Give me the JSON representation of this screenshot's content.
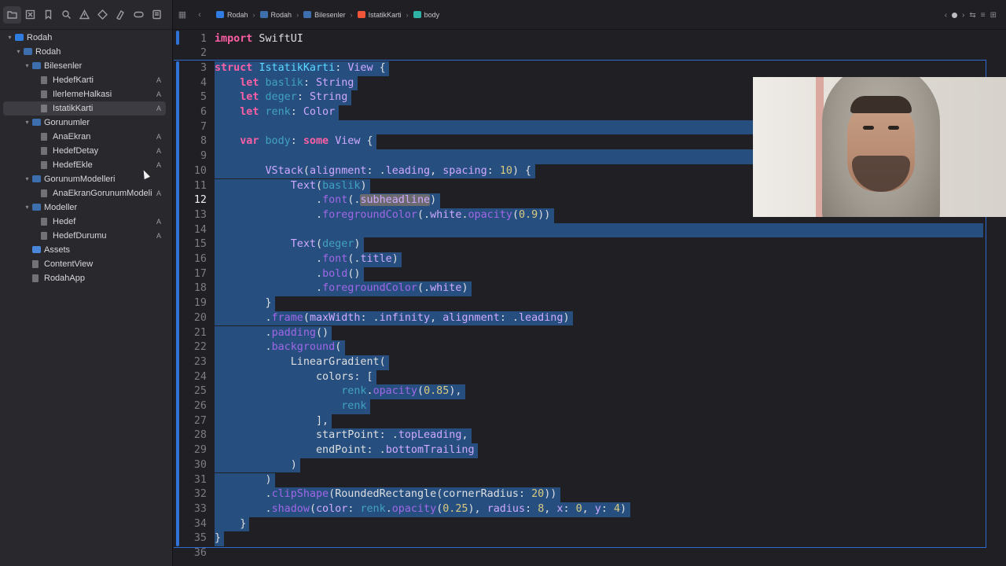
{
  "sidebar": {
    "nav_icons": [
      "folder-icon",
      "close-square-icon",
      "bookmark-icon",
      "search-icon",
      "warning-icon",
      "diamond-icon",
      "test-icon",
      "tag-icon",
      "report-icon"
    ],
    "tree": [
      {
        "label": "Rodah",
        "indent": 0,
        "chevron": "open",
        "icon": "project",
        "badge": ""
      },
      {
        "label": "Rodah",
        "indent": 1,
        "chevron": "open",
        "icon": "folder",
        "badge": ""
      },
      {
        "label": "Bilesenler",
        "indent": 2,
        "chevron": "open",
        "icon": "folder",
        "badge": ""
      },
      {
        "label": "HedefKarti",
        "indent": 3,
        "chevron": "",
        "icon": "file",
        "badge": "A"
      },
      {
        "label": "IlerlemeHalkasi",
        "indent": 3,
        "chevron": "",
        "icon": "file",
        "badge": "A"
      },
      {
        "label": "IstatikKarti",
        "indent": 3,
        "chevron": "",
        "icon": "file",
        "badge": "A",
        "selected": true
      },
      {
        "label": "Gorunumler",
        "indent": 2,
        "chevron": "open",
        "icon": "folder",
        "badge": ""
      },
      {
        "label": "AnaEkran",
        "indent": 3,
        "chevron": "",
        "icon": "file",
        "badge": "A"
      },
      {
        "label": "HedefDetay",
        "indent": 3,
        "chevron": "",
        "icon": "file",
        "badge": "A"
      },
      {
        "label": "HedefEkle",
        "indent": 3,
        "chevron": "",
        "icon": "file",
        "badge": "A"
      },
      {
        "label": "GorunumModelleri",
        "indent": 2,
        "chevron": "open",
        "icon": "folder",
        "badge": ""
      },
      {
        "label": "AnaEkranGorunumModeli",
        "indent": 3,
        "chevron": "",
        "icon": "file",
        "badge": "A"
      },
      {
        "label": "Modeller",
        "indent": 2,
        "chevron": "open",
        "icon": "folder",
        "badge": ""
      },
      {
        "label": "Hedef",
        "indent": 3,
        "chevron": "",
        "icon": "file",
        "badge": "A"
      },
      {
        "label": "HedefDurumu",
        "indent": 3,
        "chevron": "",
        "icon": "file",
        "badge": "A"
      },
      {
        "label": "Assets",
        "indent": 2,
        "chevron": "",
        "icon": "asset",
        "badge": ""
      },
      {
        "label": "ContentView",
        "indent": 2,
        "chevron": "",
        "icon": "file",
        "badge": ""
      },
      {
        "label": "RodahApp",
        "indent": 2,
        "chevron": "",
        "icon": "file",
        "badge": ""
      }
    ]
  },
  "breadcrumb": [
    {
      "label": "Rodah",
      "icon": "project",
      "color": "#2f7de0"
    },
    {
      "label": "Rodah",
      "icon": "folder",
      "color": "#3d6fae"
    },
    {
      "label": "Bilesenler",
      "icon": "folder",
      "color": "#3d6fae"
    },
    {
      "label": "IstatikKarti",
      "icon": "swift-file",
      "color": "#f0553a"
    },
    {
      "label": "body",
      "icon": "property",
      "color": "#2fb3a6"
    }
  ],
  "editor": {
    "current_line": 12,
    "selection": {
      "from_line": 3,
      "to_line": 35
    },
    "lines": [
      [
        [
          "keyword",
          "import"
        ],
        [
          "plain",
          " SwiftUI"
        ]
      ],
      [],
      [
        [
          "keyword",
          "struct"
        ],
        [
          "plain",
          " "
        ],
        [
          "type",
          "IstatikKarti"
        ],
        [
          "plain",
          ": "
        ],
        [
          "typecall",
          "View"
        ],
        [
          "plain",
          " {"
        ]
      ],
      [
        [
          "plain",
          "    "
        ],
        [
          "keyword",
          "let"
        ],
        [
          "plain",
          " "
        ],
        [
          "prop",
          "baslik"
        ],
        [
          "plain",
          ": "
        ],
        [
          "typecall",
          "String"
        ]
      ],
      [
        [
          "plain",
          "    "
        ],
        [
          "keyword",
          "let"
        ],
        [
          "plain",
          " "
        ],
        [
          "prop",
          "deger"
        ],
        [
          "plain",
          ": "
        ],
        [
          "typecall",
          "String"
        ]
      ],
      [
        [
          "plain",
          "    "
        ],
        [
          "keyword",
          "let"
        ],
        [
          "plain",
          " "
        ],
        [
          "prop",
          "renk"
        ],
        [
          "plain",
          ": "
        ],
        [
          "typecall",
          "Color"
        ]
      ],
      [],
      [
        [
          "plain",
          "    "
        ],
        [
          "keyword",
          "var"
        ],
        [
          "plain",
          " "
        ],
        [
          "prop",
          "body"
        ],
        [
          "plain",
          ": "
        ],
        [
          "keyword",
          "some"
        ],
        [
          "plain",
          " "
        ],
        [
          "typecall",
          "View"
        ],
        [
          "plain",
          " {"
        ]
      ],
      [],
      [
        [
          "plain",
          "        "
        ],
        [
          "typecall",
          "VStack"
        ],
        [
          "plain",
          "("
        ],
        [
          "member",
          "alignment"
        ],
        [
          "plain",
          ": ."
        ],
        [
          "member",
          "leading"
        ],
        [
          "plain",
          ", "
        ],
        [
          "member",
          "spacing"
        ],
        [
          "plain",
          ": "
        ],
        [
          "num",
          "10"
        ],
        [
          "plain",
          ") {"
        ]
      ],
      [
        [
          "plain",
          "            "
        ],
        [
          "typecall",
          "Text"
        ],
        [
          "plain",
          "("
        ],
        [
          "prop",
          "baslik"
        ],
        [
          "plain",
          ")"
        ]
      ],
      [
        [
          "plain",
          "                ."
        ],
        [
          "method",
          "font"
        ],
        [
          "plain",
          "(."
        ],
        [
          "findmember",
          "subheadline"
        ],
        [
          "plain",
          ")"
        ]
      ],
      [
        [
          "plain",
          "                ."
        ],
        [
          "method",
          "foregroundColor"
        ],
        [
          "plain",
          "(."
        ],
        [
          "member",
          "white"
        ],
        [
          "plain",
          "."
        ],
        [
          "method",
          "opacity"
        ],
        [
          "plain",
          "("
        ],
        [
          "num",
          "0.9"
        ],
        [
          "plain",
          "))"
        ]
      ],
      [],
      [
        [
          "plain",
          "            "
        ],
        [
          "typecall",
          "Text"
        ],
        [
          "plain",
          "("
        ],
        [
          "prop",
          "deger"
        ],
        [
          "plain",
          ")"
        ]
      ],
      [
        [
          "plain",
          "                ."
        ],
        [
          "method",
          "font"
        ],
        [
          "plain",
          "(."
        ],
        [
          "member",
          "title"
        ],
        [
          "plain",
          ")"
        ]
      ],
      [
        [
          "plain",
          "                ."
        ],
        [
          "method",
          "bold"
        ],
        [
          "plain",
          "()"
        ]
      ],
      [
        [
          "plain",
          "                ."
        ],
        [
          "method",
          "foregroundColor"
        ],
        [
          "plain",
          "(."
        ],
        [
          "member",
          "white"
        ],
        [
          "plain",
          ")"
        ]
      ],
      [
        [
          "plain",
          "        }"
        ]
      ],
      [
        [
          "plain",
          "        ."
        ],
        [
          "method",
          "frame"
        ],
        [
          "plain",
          "("
        ],
        [
          "member",
          "maxWidth"
        ],
        [
          "plain",
          ": ."
        ],
        [
          "member",
          "infinity"
        ],
        [
          "plain",
          ", "
        ],
        [
          "member",
          "alignment"
        ],
        [
          "plain",
          ": ."
        ],
        [
          "member",
          "leading"
        ],
        [
          "plain",
          ")"
        ]
      ],
      [
        [
          "plain",
          "        ."
        ],
        [
          "method",
          "padding"
        ],
        [
          "plain",
          "()"
        ]
      ],
      [
        [
          "plain",
          "        ."
        ],
        [
          "method",
          "background"
        ],
        [
          "plain",
          "("
        ]
      ],
      [
        [
          "plain",
          "            "
        ],
        [
          "plain",
          "LinearGradient"
        ],
        [
          "plain",
          "("
        ]
      ],
      [
        [
          "plain",
          "                "
        ],
        [
          "plain",
          "colors"
        ],
        [
          "plain",
          ": ["
        ]
      ],
      [
        [
          "plain",
          "                    "
        ],
        [
          "prop",
          "renk"
        ],
        [
          "plain",
          "."
        ],
        [
          "method",
          "opacity"
        ],
        [
          "plain",
          "("
        ],
        [
          "num",
          "0.85"
        ],
        [
          "plain",
          "),"
        ]
      ],
      [
        [
          "plain",
          "                    "
        ],
        [
          "prop",
          "renk"
        ]
      ],
      [
        [
          "plain",
          "                ],"
        ]
      ],
      [
        [
          "plain",
          "                "
        ],
        [
          "plain",
          "startPoint"
        ],
        [
          "plain",
          ": ."
        ],
        [
          "member",
          "topLeading"
        ],
        [
          "plain",
          ","
        ]
      ],
      [
        [
          "plain",
          "                "
        ],
        [
          "plain",
          "endPoint"
        ],
        [
          "plain",
          ": ."
        ],
        [
          "member",
          "bottomTrailing"
        ]
      ],
      [
        [
          "plain",
          "            )"
        ]
      ],
      [
        [
          "plain",
          "        )"
        ]
      ],
      [
        [
          "plain",
          "        ."
        ],
        [
          "method",
          "clipShape"
        ],
        [
          "plain",
          "("
        ],
        [
          "plain",
          "RoundedRectangle"
        ],
        [
          "plain",
          "("
        ],
        [
          "plain",
          "cornerRadius"
        ],
        [
          "plain",
          ": "
        ],
        [
          "num",
          "20"
        ],
        [
          "plain",
          "))"
        ]
      ],
      [
        [
          "plain",
          "        ."
        ],
        [
          "method",
          "shadow"
        ],
        [
          "plain",
          "("
        ],
        [
          "member",
          "color"
        ],
        [
          "plain",
          ": "
        ],
        [
          "prop",
          "renk"
        ],
        [
          "plain",
          "."
        ],
        [
          "method",
          "opacity"
        ],
        [
          "plain",
          "("
        ],
        [
          "num",
          "0.25"
        ],
        [
          "plain",
          "), "
        ],
        [
          "member",
          "radius"
        ],
        [
          "plain",
          ": "
        ],
        [
          "num",
          "8"
        ],
        [
          "plain",
          ", "
        ],
        [
          "member",
          "x"
        ],
        [
          "plain",
          ": "
        ],
        [
          "num",
          "0"
        ],
        [
          "plain",
          ", "
        ],
        [
          "member",
          "y"
        ],
        [
          "plain",
          ": "
        ],
        [
          "num",
          "4"
        ],
        [
          "plain",
          ")"
        ]
      ],
      [
        [
          "plain",
          "    }"
        ]
      ],
      [
        [
          "plain",
          "}"
        ]
      ],
      []
    ]
  }
}
